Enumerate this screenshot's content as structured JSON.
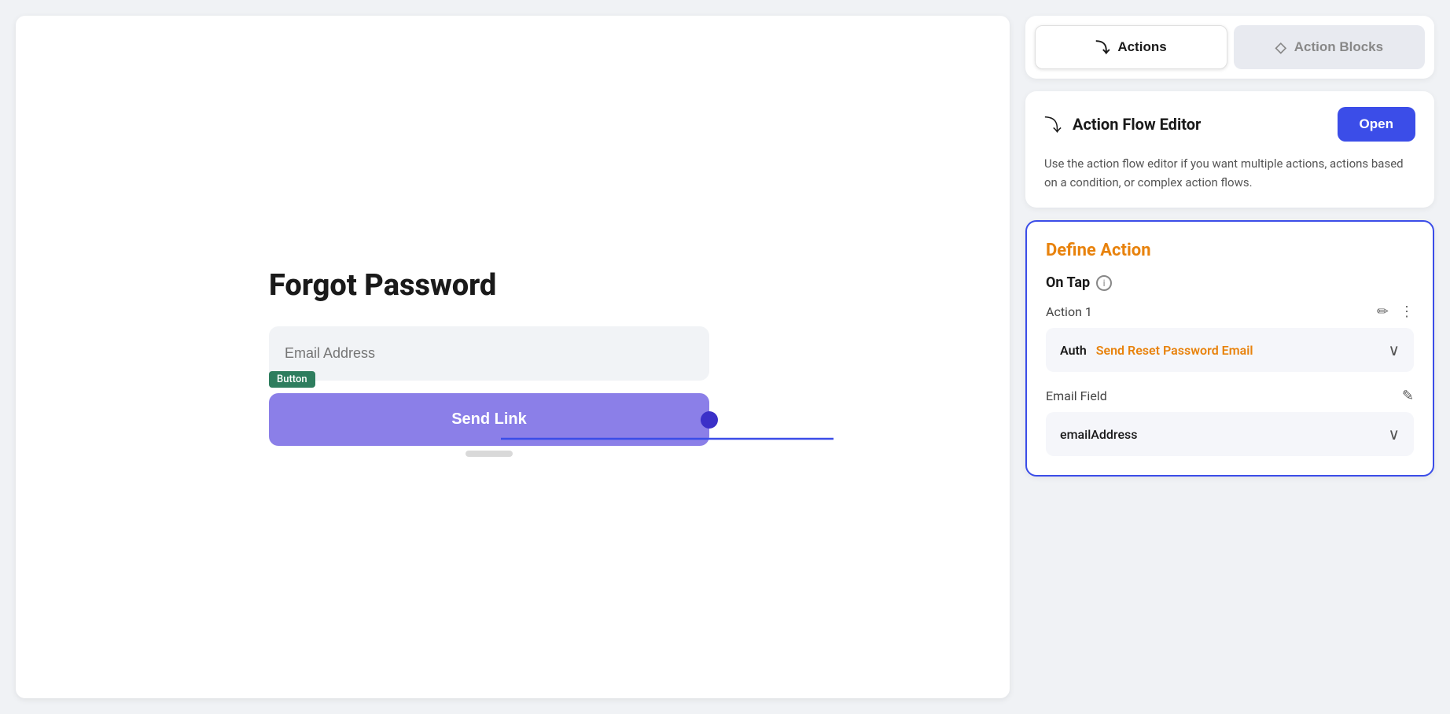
{
  "tabs": {
    "actions_label": "Actions",
    "action_blocks_label": "Action Blocks"
  },
  "action_flow": {
    "title": "Action Flow Editor",
    "open_button": "Open",
    "description": "Use the action flow editor if you want multiple actions, actions based on a condition, or complex action flows."
  },
  "define_action": {
    "title": "Define Action",
    "on_tap_label": "On Tap",
    "action_row_label": "Action 1",
    "auth_text_label": "Auth",
    "auth_text_action": "Send Reset Password Email",
    "email_field_label": "Email Field",
    "email_field_value": "emailAddress"
  },
  "canvas": {
    "page_title": "Forgot Password",
    "email_placeholder": "Email Address",
    "button_label": "Send Link",
    "button_tag": "Button"
  },
  "icons": {
    "actions_icon": "⤵",
    "action_blocks_icon": "◇",
    "action_flow_icon": "⤵",
    "info_icon": "i",
    "edit_icon": "✏",
    "more_icon": "⋮",
    "chevron": "∨",
    "edit_field_icon": "✎"
  }
}
